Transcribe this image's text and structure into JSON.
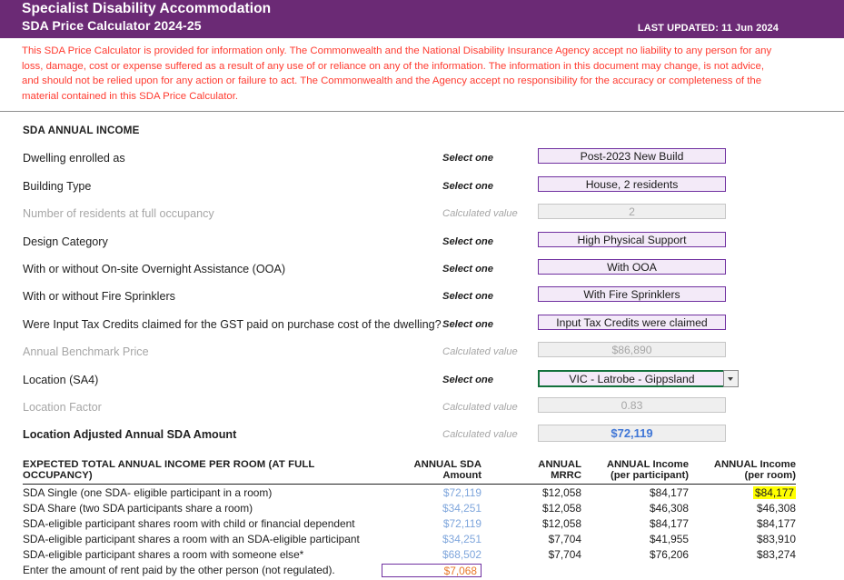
{
  "header": {
    "title_line1": "Specialist Disability Accommodation",
    "title_line2": "SDA Price Calculator 2024-25",
    "last_updated": "LAST UPDATED: 11 Jun 2024",
    "bar_color": "#6B2A75"
  },
  "disclaimer": {
    "text": "This SDA Price Calculator is provided for information only.  The Commonwealth and the National Disability Insurance Agency accept no liability to any person for any loss, damage, cost or expense suffered as a result of any use of or reliance on any of the information.  The information in this document may change, is not advice, and should not be relied upon for any action or failure to act. The Commonwealth and the Agency accept no responsibility for the accuracy or completeness of the material contained in this SDA Price Calculator.",
    "color": "#FF3B30"
  },
  "form": {
    "section_heading": "SDA ANNUAL INCOME",
    "hint_select": "Select one",
    "hint_calculated": "Calculated value",
    "rows": [
      {
        "label": "Dwelling enrolled as",
        "hint": "Select one",
        "type": "select",
        "value": "Post-2023 New Build"
      },
      {
        "label": "Building Type",
        "hint": "Select one",
        "type": "select",
        "value": "House, 2 residents"
      },
      {
        "label": "Number of residents at full occupancy",
        "hint": "Calculated value",
        "type": "calc",
        "value": "2"
      },
      {
        "label": "Design Category",
        "hint": "Select one",
        "type": "select",
        "value": "High Physical Support"
      },
      {
        "label": "With or without On-site Overnight Assistance (OOA)",
        "hint": "Select one",
        "type": "select",
        "value": "With OOA"
      },
      {
        "label": "With or without Fire Sprinklers",
        "hint": "Select one",
        "type": "select",
        "value": "With Fire Sprinklers"
      },
      {
        "label": "Were Input Tax Credits claimed for the GST paid on purchase cost of the dwelling?",
        "hint": "Select one",
        "type": "select",
        "value": "Input Tax Credits were claimed"
      },
      {
        "label": "Annual Benchmark Price",
        "hint": "Calculated value",
        "type": "calc",
        "value": "$86,890"
      },
      {
        "label": "Location (SA4)",
        "hint": "Select one",
        "type": "dropdown-active",
        "value": "VIC - Latrobe - Gippsland"
      },
      {
        "label": "Location Factor",
        "hint": "Calculated value",
        "type": "calc",
        "value": "0.83"
      },
      {
        "label": "Location Adjusted Annual SDA Amount",
        "hint": "Calculated value",
        "type": "calc-strong",
        "value": "$72,119"
      }
    ]
  },
  "table": {
    "headers": {
      "first": "EXPECTED TOTAL ANNUAL INCOME PER ROOM (AT FULL OCCUPANCY)",
      "col1_line1": "ANNUAL SDA",
      "col1_line2": "Amount",
      "col2_line1": "ANNUAL",
      "col2_line2": "MRRC",
      "col3_line1": "ANNUAL Income",
      "col3_line2": "(per participant)",
      "col4_line1": "ANNUAL Income",
      "col4_line2": "(per room)"
    },
    "rows": [
      {
        "label": "SDA Single (one SDA- eligible participant in a room)",
        "sda_amount": "$72,119",
        "mrrc": "$12,058",
        "per_participant": "$84,177",
        "per_room": "$84,177",
        "per_room_highlighted": true
      },
      {
        "label": "SDA Share (two SDA participants share a room)",
        "sda_amount": "$34,251",
        "mrrc": "$12,058",
        "per_participant": "$46,308",
        "per_room": "$46,308",
        "per_room_highlighted": false
      },
      {
        "label": "SDA-eligible participant shares room with child or financial dependent",
        "sda_amount": "$72,119",
        "mrrc": "$12,058",
        "per_participant": "$84,177",
        "per_room": "$84,177",
        "per_room_highlighted": false
      },
      {
        "label": "SDA-eligible participant shares a room with an SDA-eligible participant",
        "sda_amount": "$34,251",
        "mrrc": "$7,704",
        "per_participant": "$41,955",
        "per_room": "$83,910",
        "per_room_highlighted": false
      },
      {
        "label": "SDA-eligible participant shares a room with someone else*",
        "sda_amount": "$68,502",
        "mrrc": "$7,704",
        "per_participant": "$76,206",
        "per_room": "$83,274",
        "per_room_highlighted": false
      }
    ],
    "rent_row": {
      "label": "Enter the amount of rent paid by the other person (not regulated).",
      "value": "$7,068"
    }
  },
  "colors": {
    "accent_purple": "#7030A0",
    "header_purple": "#6B2A75",
    "select_fill": "#F3EAF8",
    "calc_fill": "#EFEFEF",
    "blue_value": "#3F76D6",
    "sda_blue": "#7FA6DC",
    "highlight_yellow": "#FFFF00",
    "rent_orange": "#E8792A",
    "active_cell_green": "#14713D"
  }
}
